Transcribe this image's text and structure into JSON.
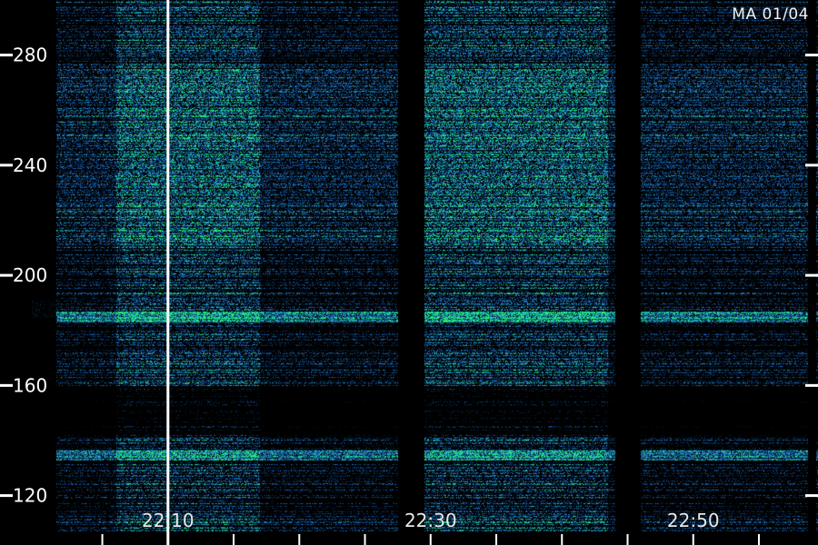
{
  "chart_data": {
    "type": "heatmap",
    "stamp": "MA 01/04",
    "y_ticks": [
      280,
      240,
      200,
      160,
      120
    ],
    "ylim": [
      107,
      300
    ],
    "x_ticks": [
      "22:10",
      "22:30",
      "22:50"
    ],
    "x_tick_minutes": [
      10,
      30,
      50
    ],
    "xlim_minutes": [
      1.5,
      59.5
    ],
    "colors": {
      "low": "#000000",
      "mid": "#1c6fd0",
      "high": "#22f07a",
      "marker": "#ffffff"
    },
    "marker_line_minute": 10,
    "gap_minutes": [
      [
        27.5,
        29.5
      ],
      [
        44.0,
        46.0
      ],
      [
        58.7,
        59.3
      ]
    ],
    "bright_bands_minutes": [
      [
        6.0,
        17.0
      ],
      [
        29.5,
        43.5
      ]
    ],
    "bright_lines_y": [
      185,
      135
    ]
  }
}
